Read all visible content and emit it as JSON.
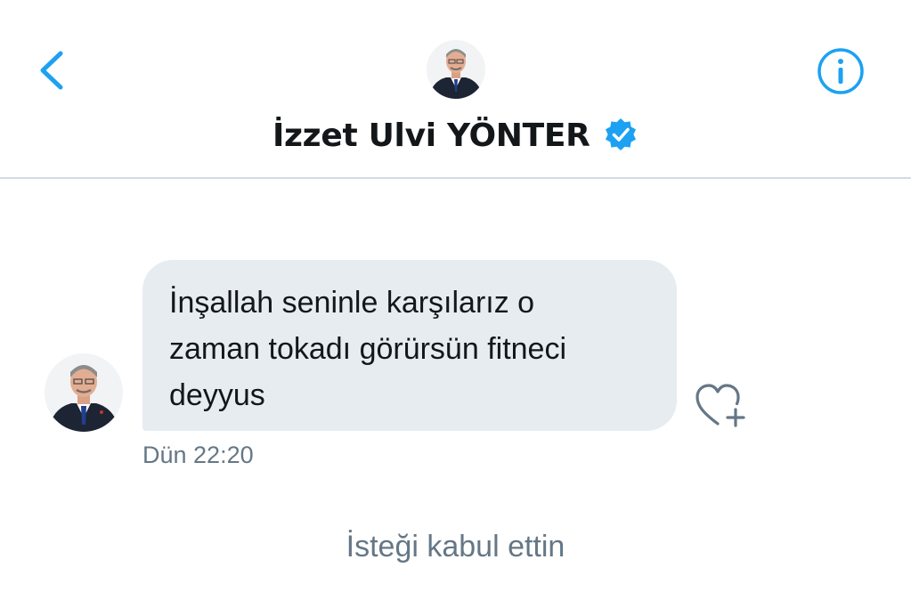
{
  "header": {
    "title": "İzzet Ulvi YÖNTER",
    "verified": true,
    "back_icon": "chevron-left-icon",
    "info_icon": "info-circle-icon"
  },
  "conversation": {
    "message": {
      "text": "İnşallah seninle karşılarız o\nzaman tokadı görürsün fitneci\ndeyyus",
      "time": "Dün 22:20",
      "reaction_icon": "heart-plus-icon"
    },
    "request_status": "İsteği kabul ettin"
  },
  "colors": {
    "accent": "#1da1f2",
    "bubble": "#e6ecf0",
    "text": "#14171a",
    "muted": "#657786",
    "divider": "#d4dbe2"
  }
}
